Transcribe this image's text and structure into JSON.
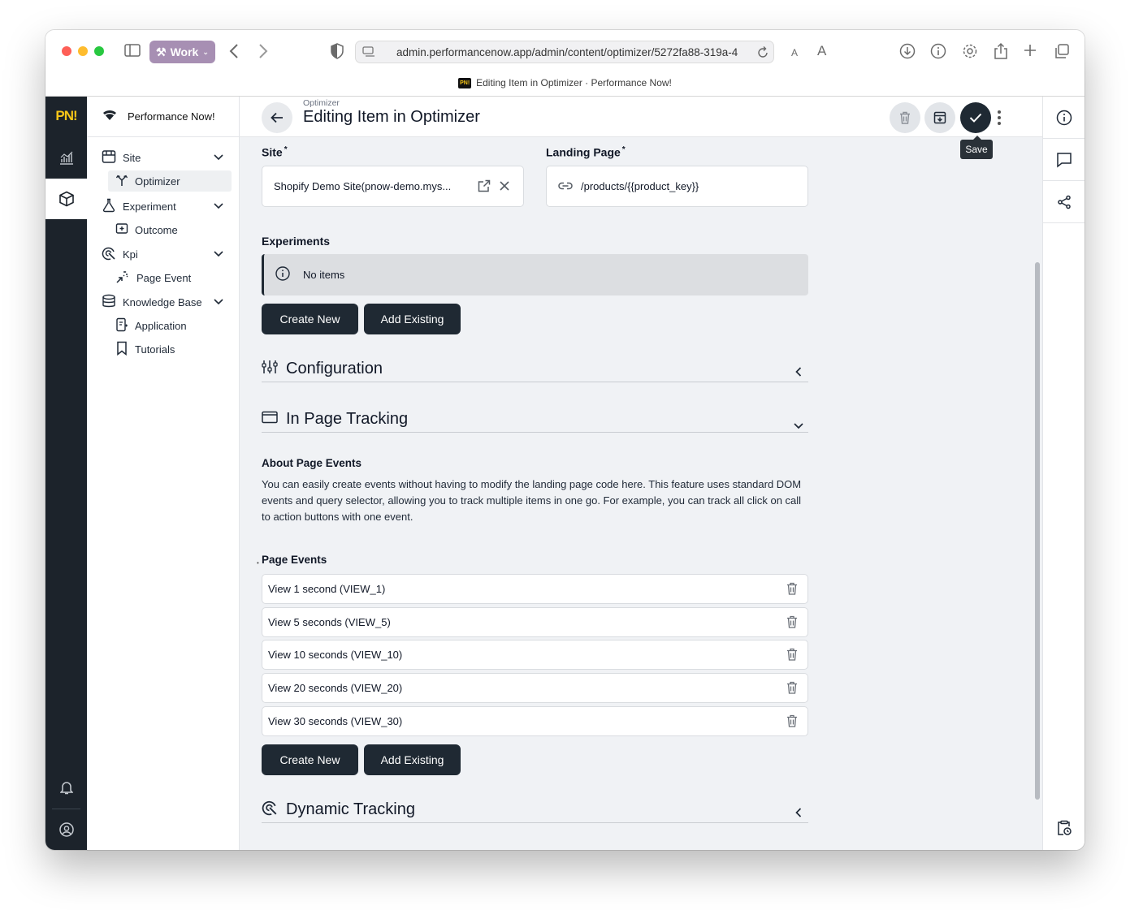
{
  "browser": {
    "profile_label": "Work",
    "url": "admin.performancenow.app/admin/content/optimizer/5272fa88-319a-4",
    "tab_title": "Editing Item in Optimizer · Performance Now!",
    "tab_favicon_text": "PN!",
    "text_size_small": "A",
    "text_size_large": "A"
  },
  "rail": {
    "logo": "PN!",
    "items": [
      {
        "icon": "analytics-chart-icon",
        "active": false
      },
      {
        "icon": "cube-content-icon",
        "active": true
      }
    ],
    "bottom": [
      {
        "icon": "bell-icon"
      },
      {
        "icon": "user-circle-icon"
      }
    ]
  },
  "nav": {
    "brand": "Performance Now!",
    "groups": [
      {
        "label": "Site",
        "icon": "storefront-icon",
        "children": [
          {
            "label": "Optimizer",
            "icon": "fork-icon",
            "active": true
          }
        ]
      },
      {
        "label": "Experiment",
        "icon": "flask-icon",
        "children": [
          {
            "label": "Outcome",
            "icon": "outcome-icon"
          }
        ]
      },
      {
        "label": "Kpi",
        "icon": "target-icon",
        "children": [
          {
            "label": "Page Event",
            "icon": "cursor-click-icon"
          }
        ]
      },
      {
        "label": "Knowledge Base",
        "icon": "database-icon",
        "children": [
          {
            "label": "Application",
            "icon": "app-icon"
          },
          {
            "label": "Tutorials",
            "icon": "bookmark-icon"
          }
        ]
      }
    ]
  },
  "header": {
    "breadcrumb": "Optimizer",
    "title": "Editing Item in Optimizer",
    "tooltip": "Save"
  },
  "form": {
    "site_label": "Site",
    "site_value": "Shopify Demo Site(pnow-demo.mys...",
    "landing_label": "Landing Page",
    "landing_value": "/products/{{product_key}}",
    "required_mark": "*",
    "experiments_label": "Experiments",
    "experiments_empty": "No items",
    "create_new": "Create New",
    "add_existing": "Add Existing"
  },
  "sections": {
    "configuration": "Configuration",
    "in_page_tracking": "In Page Tracking",
    "dynamic_tracking": "Dynamic Tracking"
  },
  "about": {
    "title": "About Page Events",
    "text": "You can easily create events without having to modify the landing page code here. This feature uses standard DOM events and query selector, allowing you to track multiple items in one go. For example, you can track all click on call to action buttons with one event."
  },
  "page_events": {
    "label": "Page Events",
    "items": [
      "View 1 second (VIEW_1)",
      "View 5 seconds (VIEW_5)",
      "View 10 seconds (VIEW_10)",
      "View 20 seconds (VIEW_20)",
      "View 30 seconds (VIEW_30)"
    ],
    "create_new": "Create New",
    "add_existing": "Add Existing"
  },
  "colors": {
    "accent_dark": "#1f2933",
    "logo_yellow": "#f5c518",
    "rail_bg": "#1c232b"
  }
}
